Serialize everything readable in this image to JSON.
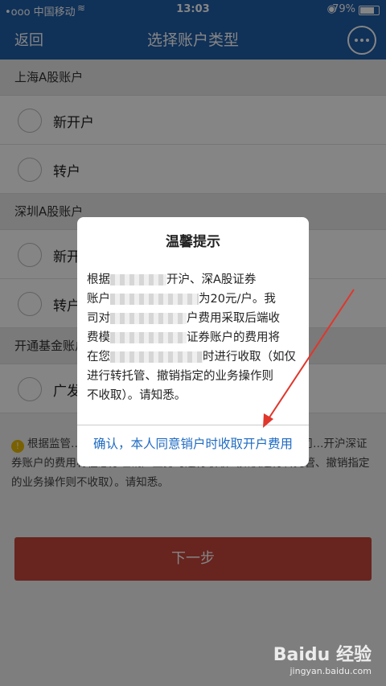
{
  "status_bar": {
    "carrier": "•ooo 中国移动",
    "time": "13:03",
    "battery": "79%"
  },
  "nav": {
    "back_label": "返回",
    "title": "选择账户类型",
    "chat_icon": "chat-bubble-icon"
  },
  "sections": [
    {
      "header": "上海A股账户",
      "options": [
        "新开户",
        "转户"
      ]
    },
    {
      "header": "深圳A股账户",
      "options": [
        "新开户",
        "转户"
      ]
    },
    {
      "header": "开通基金账户",
      "options": [
        "广发"
      ]
    }
  ],
  "notice": {
    "icon": "info-icon",
    "text": "根据监管…，新开沪深A股证券账户的费用为20元/户。我司…开沪深证券账户的费用将在您办理销户业务时进行收取（如仅进行转托管、撤销指定的业务操作则不收取）。请知悉。"
  },
  "next_button": "下一步",
  "dialog": {
    "title": "温馨提示",
    "body": {
      "line1_pre": "根据",
      "line1_post": "开沪、深A股证券",
      "line2_pre": "账户",
      "line2_post": "为20元/户。我",
      "line3_pre": "司对",
      "line3_post": "户费用采取后端收",
      "line4_pre": "费模",
      "line4_post": "证券账户的费用将",
      "line5_pre": "在您",
      "line5_post": "时进行收取（如仅",
      "line6": "进行转托管、撤销指定的业务操作则",
      "line7": "不收取）。请知悉。"
    },
    "confirm": "确认，本人同意销户时收取开户费用"
  },
  "watermark": {
    "brand": "Baidu 经验",
    "url": "jingyan.baidu.com"
  }
}
